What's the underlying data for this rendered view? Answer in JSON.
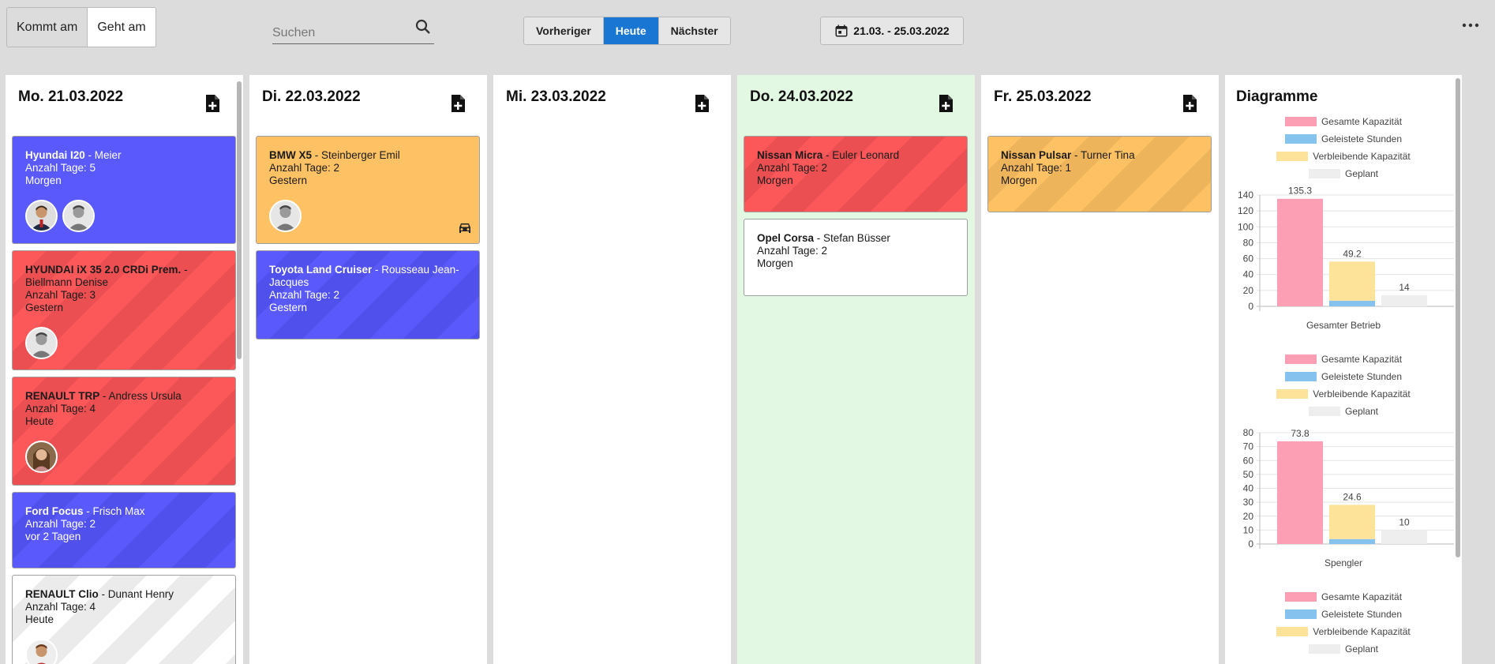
{
  "toolbar": {
    "toggle": [
      {
        "label": "Kommt am",
        "active": false
      },
      {
        "label": "Geht am",
        "active": true
      }
    ],
    "search_placeholder": "Suchen",
    "nav": [
      {
        "label": "Vorheriger",
        "active": false
      },
      {
        "label": "Heute",
        "active": true
      },
      {
        "label": "Nächster",
        "active": false
      }
    ],
    "date_range": "21.03. - 25.03.2022"
  },
  "columns": [
    {
      "title": "Mo. 21.03.2022",
      "cards": [
        {
          "car": "Hyundai I20",
          "person": " - Meier",
          "days": "Anzahl Tage: 5",
          "when": "Morgen",
          "color": "#5a5afc"
        },
        {
          "car": "HYUNDAI iX 35 2.0 CRDi Prem.",
          "person": " - Biellmann Denise",
          "days": "Anzahl Tage: 3",
          "when": "Gestern",
          "color": "#fc585a"
        },
        {
          "car": "RENAULT TRP",
          "person": " - Andress Ursula",
          "days": "Anzahl Tage: 4",
          "when": "Heute",
          "color": "#fc585a"
        },
        {
          "car": "Ford Focus",
          "person": " - Frisch Max",
          "days": "Anzahl Tage: 2",
          "when": "vor 2 Tagen",
          "color": "#5a5afc"
        },
        {
          "car": "RENAULT Clio",
          "person": " - Dunant Henry",
          "days": "Anzahl Tage: 4",
          "when": "Heute",
          "color": "#ffffff"
        }
      ]
    },
    {
      "title": "Di. 22.03.2022",
      "cards": [
        {
          "car": "BMW X5",
          "person": " - Steinberger Emil",
          "days": "Anzahl Tage: 2",
          "when": "Gestern",
          "color": "#fec264"
        },
        {
          "car": "Toyota Land Cruiser",
          "person": " - Rousseau Jean-Jacques",
          "days": "Anzahl Tage: 2",
          "when": "Gestern",
          "color": "#5a5afc"
        }
      ]
    },
    {
      "title": "Mi. 23.03.2022",
      "cards": []
    },
    {
      "title": "Do. 24.03.2022",
      "cards": [
        {
          "car": "Nissan Micra",
          "person": " - Euler Leonard",
          "days": "Anzahl Tage: 2",
          "when": "Morgen",
          "color": "#fc585a"
        },
        {
          "car": "Opel Corsa",
          "person": " - Stefan Büsser",
          "days": "Anzahl Tage: 2",
          "when": "Morgen",
          "color": "#ffffff"
        }
      ]
    },
    {
      "title": "Fr. 25.03.2022",
      "cards": [
        {
          "car": "Nissan Pulsar",
          "person": " - Turner Tina",
          "days": "Anzahl Tage: 1",
          "when": "Morgen",
          "color": "#fec264"
        }
      ]
    }
  ],
  "diagram": {
    "title": "Diagramme",
    "legend": [
      {
        "label": "Gesamte Kapazität",
        "color": "#fc9fb4"
      },
      {
        "label": "Geleistete Stunden",
        "color": "#86c2ee"
      },
      {
        "label": "Verbleibende Kapazität",
        "color": "#fde29a"
      },
      {
        "label": "Geplant",
        "color": "#eeeeee"
      }
    ]
  },
  "chart_data": [
    {
      "type": "bar",
      "categories": [
        "Gesamter Betrieb"
      ],
      "xlabel": "Gesamter Betrieb",
      "ylim": [
        0,
        140
      ],
      "yticks": [
        0,
        20,
        40,
        60,
        80,
        100,
        120,
        140
      ],
      "grid": true,
      "legend_position": "top",
      "series": [
        {
          "name": "Gesamte Kapazität",
          "values": [
            135.3
          ],
          "color": "#fc9fb4",
          "stack": "a"
        },
        {
          "name": "Geleistete Stunden",
          "values": [
            7.07
          ],
          "color": "#86c2ee",
          "stack": "b"
        },
        {
          "name": "Verbleibende Kapazität",
          "values": [
            49.2
          ],
          "color": "#fde29a",
          "stack": "b"
        },
        {
          "name": "Geplant",
          "values": [
            14
          ],
          "color": "#eeeeee",
          "stack": "c"
        }
      ]
    },
    {
      "type": "bar",
      "categories": [
        "Spengler"
      ],
      "xlabel": "Spengler",
      "ylim": [
        0,
        80
      ],
      "yticks": [
        0,
        10,
        20,
        30,
        40,
        50,
        60,
        70,
        80
      ],
      "grid": true,
      "legend_position": "top",
      "series": [
        {
          "name": "Gesamte Kapazität",
          "values": [
            73.8
          ],
          "color": "#fc9fb4",
          "stack": "a"
        },
        {
          "name": "Geleistete Stunden",
          "values": [
            3.53
          ],
          "color": "#86c2ee",
          "stack": "b"
        },
        {
          "name": "Verbleibende Kapazität",
          "values": [
            24.6
          ],
          "color": "#fde29a",
          "stack": "b"
        },
        {
          "name": "Geplant",
          "values": [
            10
          ],
          "color": "#eeeeee",
          "stack": "c"
        }
      ]
    }
  ]
}
